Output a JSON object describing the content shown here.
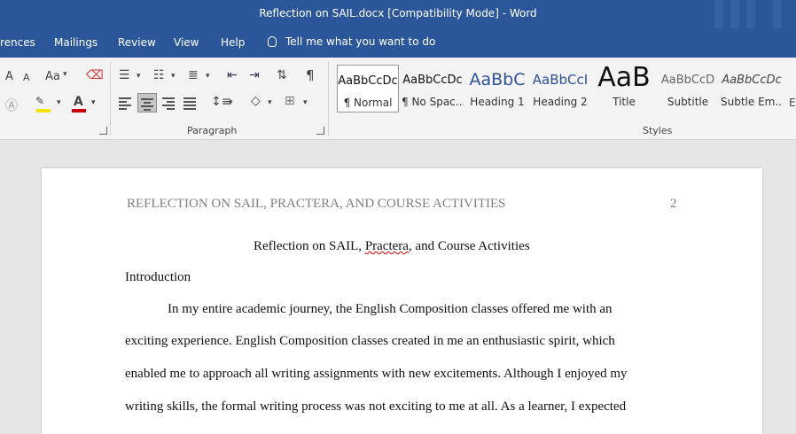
{
  "window": {
    "title": "Reflection on SAIL.docx [Compatibility Mode]  -  Word"
  },
  "menu": {
    "items": [
      "rences",
      "Mailings",
      "Review",
      "View",
      "Help"
    ],
    "tell_me": "Tell me what you want to do"
  },
  "ribbon": {
    "font_group": {
      "size_label": "Aa",
      "grow": "A",
      "shrink": "A"
    },
    "paragraph_label": "Paragraph",
    "styles_label": "Styles",
    "styles": [
      {
        "preview": "AaBbCcDc",
        "name": "¶ Normal"
      },
      {
        "preview": "AaBbCcDc",
        "name": "¶ No Spac..."
      },
      {
        "preview": "AaBbC",
        "name": "Heading 1"
      },
      {
        "preview": "AaBbCcI",
        "name": "Heading 2"
      },
      {
        "preview": "AaB",
        "name": "Title"
      },
      {
        "preview": "AaBbCcD",
        "name": "Subtitle"
      },
      {
        "preview": "AaBbCcDc",
        "name": "Subtle Em..."
      }
    ]
  },
  "document": {
    "running_head": "REFLECTION ON SAIL, PRACTERA, AND COURSE ACTIVITIES",
    "page_number": "2",
    "title_a": "Reflection on SAIL, ",
    "title_b": "Practera",
    "title_c": ", and Course Activities",
    "heading": "Introduction",
    "lines": [
      "In my entire academic journey, the English Composition classes offered me with an",
      "exciting experience. English Composition classes created in me an enthusiastic spirit, which",
      "enabled me to approach all writing assignments with new excitements. Although I enjoyed my",
      "writing skills, the formal writing process was not exciting to me at all. As a learner, I expected"
    ]
  }
}
